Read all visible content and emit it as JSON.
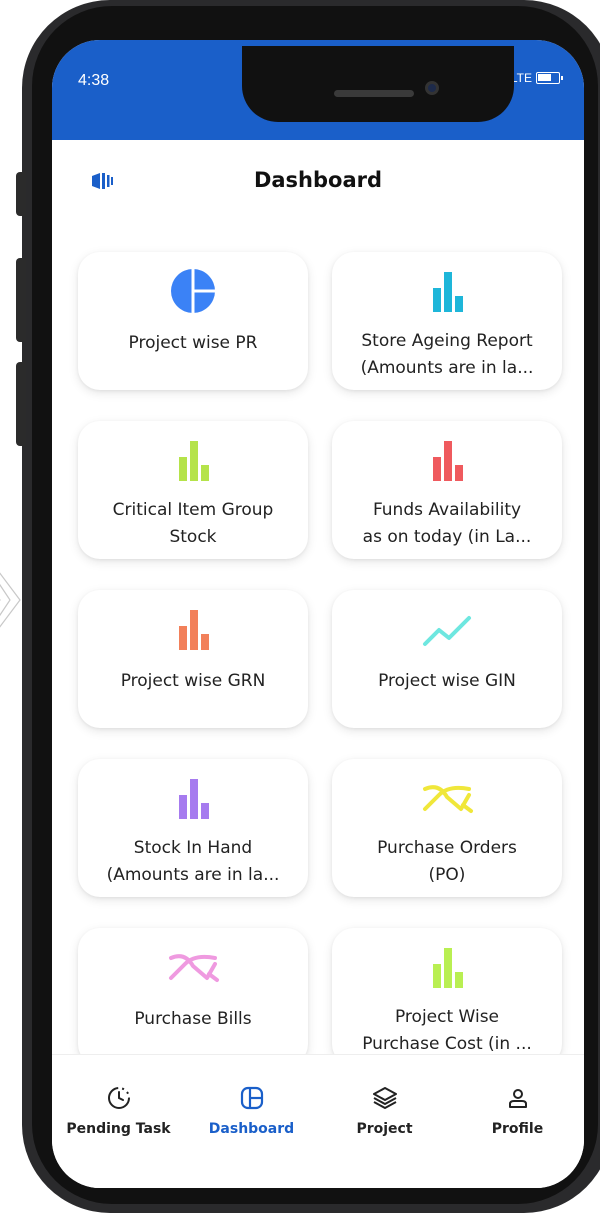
{
  "status_bar": {
    "time": "4:38",
    "network": "LTE",
    "battery_level": 0.7
  },
  "header": {
    "title": "Dashboard",
    "menu_icon": "sidebar-toggle-icon"
  },
  "cards": [
    {
      "label_line1": "Project wise PR",
      "label_line2": "",
      "icon": "pie-chart-icon",
      "color": "#3b82f6"
    },
    {
      "label_line1": "Store Ageing Report",
      "label_line2": "(Amounts are in la...",
      "icon": "bar-chart-icon",
      "color": "#1eb6d9"
    },
    {
      "label_line1": "Critical Item Group",
      "label_line2": "Stock",
      "icon": "bar-chart-icon",
      "color": "#b5e34a"
    },
    {
      "label_line1": "Funds Availability",
      "label_line2": "as on today (in La...",
      "icon": "bar-chart-icon",
      "color": "#ef5a5e"
    },
    {
      "label_line1": "Project wise GRN",
      "label_line2": "",
      "icon": "bar-chart-icon",
      "color": "#f2805a"
    },
    {
      "label_line1": "Project wise GIN",
      "label_line2": "",
      "icon": "trend-line-icon",
      "color": "#6ee7e0"
    },
    {
      "label_line1": "Stock In Hand",
      "label_line2": "(Amounts are in la...",
      "icon": "bar-chart-icon",
      "color": "#a67bef"
    },
    {
      "label_line1": "Purchase Orders",
      "label_line2": "(PO)",
      "icon": "crossing-lines-icon",
      "color": "#f0e73a"
    },
    {
      "label_line1": "Purchase Bills",
      "label_line2": "",
      "icon": "crossing-lines-icon",
      "color": "#ef9ae0"
    },
    {
      "label_line1": "Project Wise",
      "label_line2": "Purchase Cost (in ...",
      "icon": "bar-chart-icon",
      "color": "#b9ef52"
    }
  ],
  "bottom_nav": [
    {
      "label": "Pending Task",
      "icon": "clock-icon",
      "active": false
    },
    {
      "label": "Dashboard",
      "icon": "dashboard-grid-icon",
      "active": true
    },
    {
      "label": "Project",
      "icon": "layers-icon",
      "active": false
    },
    {
      "label": "Profile",
      "icon": "person-icon",
      "active": false
    }
  ],
  "colors": {
    "accent": "#1a5fc9"
  }
}
